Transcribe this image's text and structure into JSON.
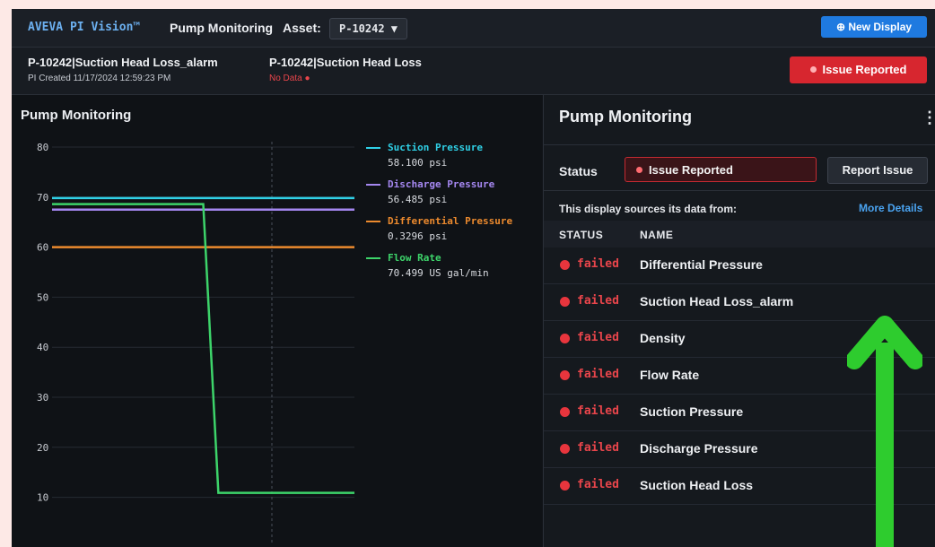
{
  "topbar": {
    "brand": "AVEVA PI Vision™",
    "title": "Pump Monitoring",
    "asset_label": "Asset:",
    "asset_value": "P-10242 ▼",
    "new_display": "⊕ New Display"
  },
  "subbar": {
    "item1_title": "P-10242|Suction Head Loss_alarm",
    "item1_meta": "PI Created   11/17/2024 12:59:23 PM",
    "item2_title": "P-10242|Suction Head Loss",
    "item2_meta": "No Data",
    "issue_button": "Issue Reported"
  },
  "left_panel": {
    "title": "Pump Monitoring"
  },
  "chart_data": {
    "type": "line",
    "ylim": [
      5,
      85
    ],
    "yticks": [
      80,
      70,
      60,
      50,
      40,
      30,
      20,
      10
    ],
    "x": [
      0,
      45,
      50,
      55,
      100
    ],
    "series": [
      {
        "name": "Suction Pressure",
        "color": "#2fd0e6",
        "value": "58.100 psi",
        "values": [
          69.8,
          69.8,
          69.8,
          69.8,
          69.8
        ]
      },
      {
        "name": "Discharge Pressure",
        "color": "#a487f0",
        "value": "56.485 psi",
        "values": [
          67.5,
          67.5,
          67.5,
          67.5,
          67.5
        ]
      },
      {
        "name": "Differential Pressure",
        "color": "#ec8a2e",
        "value": "0.3296 psi",
        "values": [
          60,
          60,
          60,
          60,
          60
        ]
      },
      {
        "name": "Flow Rate",
        "color": "#3dd46a",
        "value": "70.499 US gal/min",
        "values": [
          68.6,
          68.6,
          68.6,
          10.9,
          10.9
        ]
      }
    ]
  },
  "right_panel": {
    "title": "Pump Monitoring",
    "menu": "⋮",
    "status_label": "Status",
    "status_value": "Issue Reported",
    "report_button": "Report Issue",
    "sources_label": "This display sources its data from:",
    "more_details": "More Details",
    "col_status": "STATUS",
    "col_name": "NAME",
    "rows": [
      {
        "status": "failed",
        "name": "Differential Pressure"
      },
      {
        "status": "failed",
        "name": "Suction Head Loss_alarm"
      },
      {
        "status": "failed",
        "name": "Density"
      },
      {
        "status": "failed",
        "name": "Flow Rate"
      },
      {
        "status": "failed",
        "name": "Suction Pressure"
      },
      {
        "status": "failed",
        "name": "Discharge Pressure"
      },
      {
        "status": "failed",
        "name": "Suction Head Loss"
      }
    ]
  },
  "colors": {
    "accent": "#1f7ae0",
    "alert": "#d7262f",
    "arrow": "#2ecc2e"
  }
}
